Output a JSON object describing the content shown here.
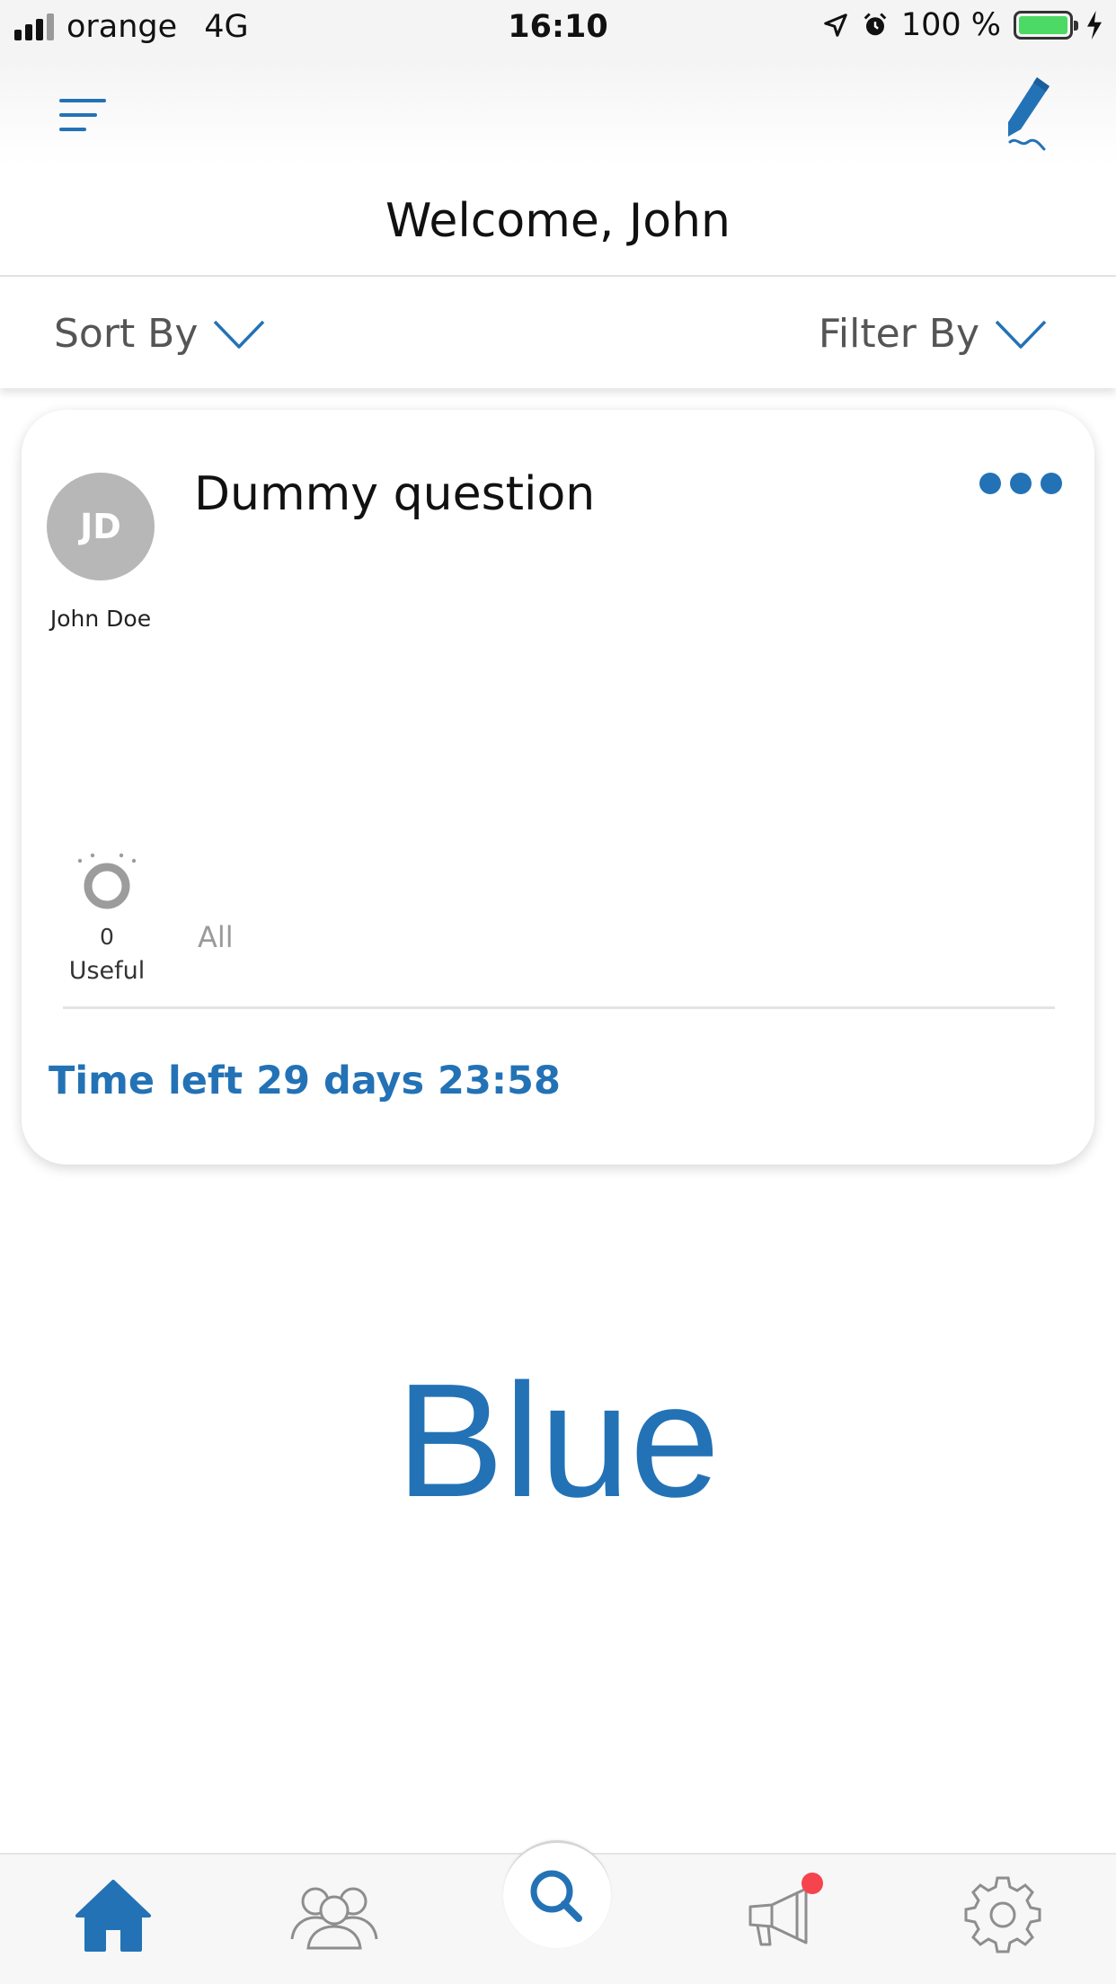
{
  "status_bar": {
    "carrier": "orange",
    "network": "4G",
    "time": "16:10",
    "battery_text": "100 %"
  },
  "header": {
    "menu_icon": "hamburger-icon",
    "compose_icon": "pencil-icon",
    "welcome": "Welcome, John"
  },
  "controls": {
    "sort_label": "Sort By",
    "filter_label": "Filter By"
  },
  "card": {
    "avatar_initials": "JD",
    "author": "John Doe",
    "title": "Dummy question",
    "useful_count": "0",
    "useful_label": "Useful",
    "all_label": "All",
    "time_left": "Time left 29 days 23:58"
  },
  "big_word": "Blue",
  "tabs": [
    {
      "name": "home",
      "icon": "home-icon",
      "active": true
    },
    {
      "name": "people",
      "icon": "people-icon",
      "active": false
    },
    {
      "name": "search",
      "icon": "search-icon",
      "active": false
    },
    {
      "name": "announcements",
      "icon": "megaphone-icon",
      "active": false,
      "badge": true
    },
    {
      "name": "settings",
      "icon": "gear-icon",
      "active": false
    }
  ],
  "colors": {
    "accent": "#2372b6",
    "badge": "#f5444d",
    "battery": "#4cd964",
    "avatar": "#b7b7b7"
  }
}
